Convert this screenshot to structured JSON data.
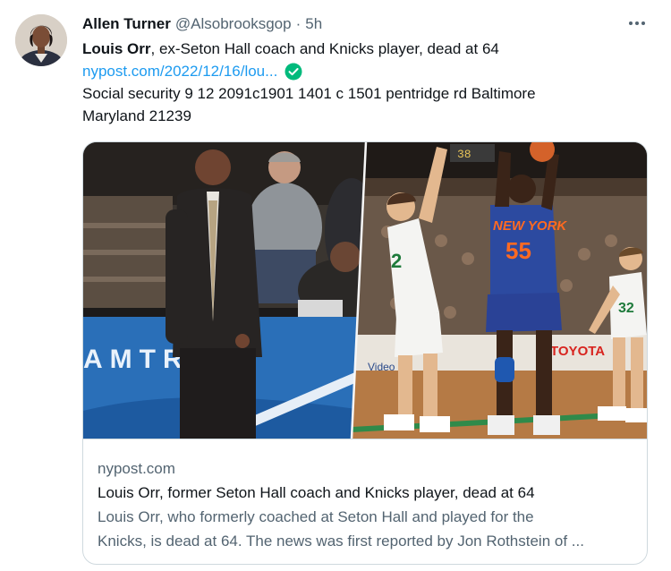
{
  "tweet": {
    "author_name": "Allen Turner",
    "author_handle": "@Alsobrooksgop",
    "separator": "·",
    "timestamp": "5h",
    "text": {
      "line1_bold": "Louis Orr",
      "line1_rest": ", ex-Seton Hall coach and Knicks player, dead at 64",
      "link": "nypost.com/2022/12/16/lou...",
      "line3": "Social security 9 12 2091c1901 1401 c 1501 pentridge rd Baltimore",
      "line4": "Maryland 21239"
    },
    "icons": {
      "more": "more-horizontal-icon",
      "check": "check-circle-icon"
    },
    "colors": {
      "link": "#1d9bf0",
      "check": "#00ba7c",
      "secondary_text": "#536471",
      "border": "#cfd9de"
    }
  },
  "card": {
    "domain": "nypost.com",
    "title": "Louis Orr, former Seton Hall coach and Knicks player, dead at 64",
    "description_line1": "Louis Orr, who formerly coached at Seton Hall and played for the",
    "description_line2": "Knicks, is dead at 64. The news was first reported by Jon Rothstein of ...",
    "image": {
      "court_banner": "AMTRAK",
      "jersey_text": "NEW YORK",
      "jersey_number": "55",
      "left_player_number": "2",
      "right_player_number": "32",
      "ad_text": "TOYOTA",
      "video_text": "Video",
      "score_text": "38"
    }
  }
}
